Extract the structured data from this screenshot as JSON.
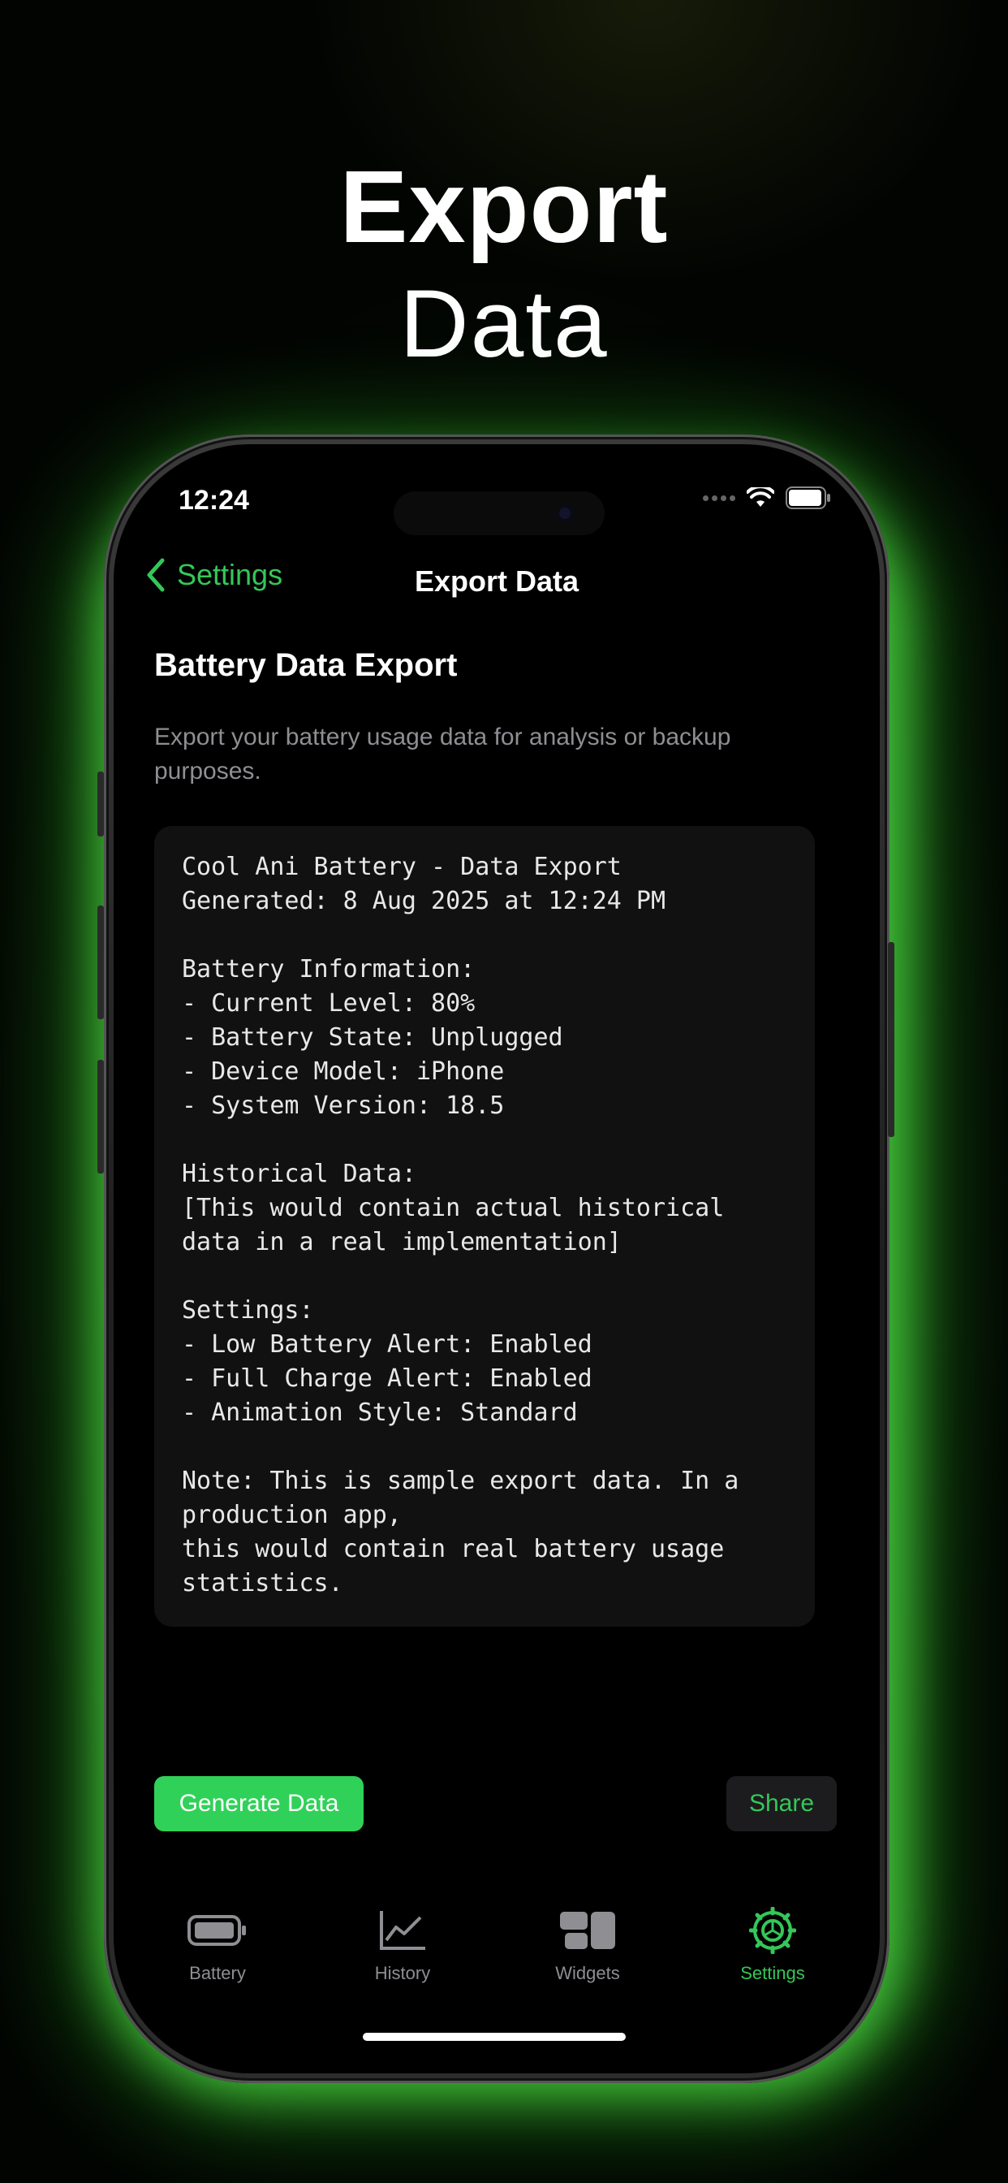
{
  "headline": {
    "line1": "Export",
    "line2": "Data"
  },
  "status_bar": {
    "time": "12:24"
  },
  "nav": {
    "back_label": "Settings",
    "title": "Export Data"
  },
  "section": {
    "title": "Battery Data Export",
    "description": "Export your battery usage data for analysis or backup purposes."
  },
  "export_text": "Cool Ani Battery - Data Export\nGenerated: 8 Aug 2025 at 12:24 PM\n\nBattery Information:\n- Current Level: 80%\n- Battery State: Unplugged\n- Device Model: iPhone\n- System Version: 18.5\n\nHistorical Data:\n[This would contain actual historical\ndata in a real implementation]\n\nSettings:\n- Low Battery Alert: Enabled\n- Full Charge Alert: Enabled\n- Animation Style: Standard\n\nNote: This is sample export data. In a\nproduction app,\nthis would contain real battery usage\nstatistics.",
  "actions": {
    "generate_label": "Generate Data",
    "share_label": "Share"
  },
  "tabs": [
    {
      "label": "Battery",
      "icon": "battery-icon",
      "active": false
    },
    {
      "label": "History",
      "icon": "chart-icon",
      "active": false
    },
    {
      "label": "Widgets",
      "icon": "widgets-icon",
      "active": false
    },
    {
      "label": "Settings",
      "icon": "gear-icon",
      "active": true
    }
  ],
  "colors": {
    "accent": "#34c759",
    "generate_button": "#30d158",
    "glow": "#50e646"
  }
}
